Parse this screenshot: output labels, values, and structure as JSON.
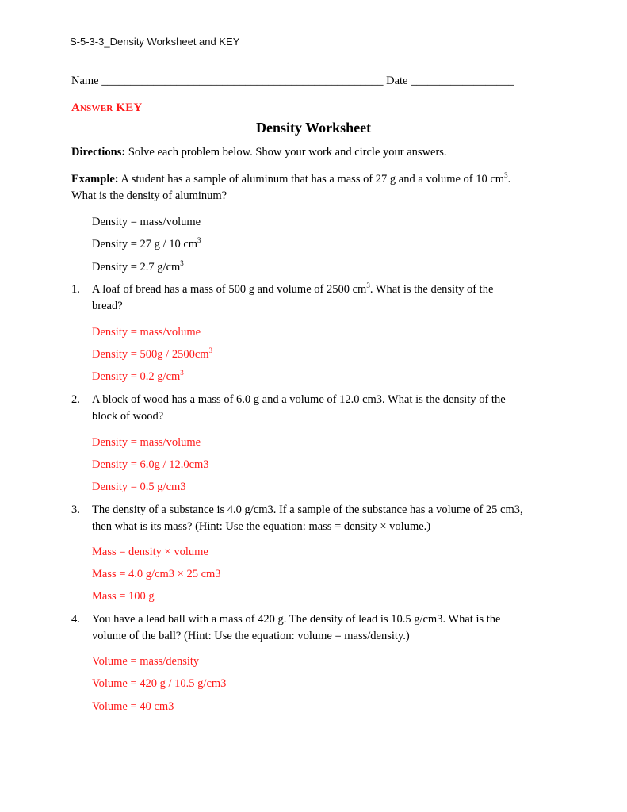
{
  "header": {
    "file_title": "S-5-3-3_Density Worksheet and KEY"
  },
  "form": {
    "name_label": "Name",
    "name_blank": "_________________________________________________",
    "date_label": "Date",
    "date_blank": "__________________"
  },
  "answer_key_label": "Answer KEY",
  "title": "Density Worksheet",
  "directions": {
    "label": "Directions:",
    "text": " Solve each problem below. Show your work and circle your answers."
  },
  "example": {
    "label": "Example:",
    "text_line1": " A student has a sample of aluminum that has a mass of 27 g and a volume of 10 cm",
    "sup": "3",
    "text_line1_end": ".",
    "text_line2": "What is the density of aluminum?",
    "steps": [
      {
        "text": "Density = mass/volume",
        "sup": ""
      },
      {
        "text": "Density = 27 g / 10 cm",
        "sup": "3"
      },
      {
        "text": "Density = 2.7 g/cm",
        "sup": "3"
      }
    ]
  },
  "problems": [
    {
      "number": "1.",
      "line1": "A loaf of bread has a mass of 500 g and volume of 2500 cm",
      "line1_sup": "3",
      "line1_end": ". What is the density of the",
      "line2": "bread?",
      "answers": [
        {
          "text": "Density = mass/volume",
          "sup": ""
        },
        {
          "text": "Density = 500g / 2500cm",
          "sup": "3"
        },
        {
          "text": "Density = 0.2 g/cm",
          "sup": "3"
        }
      ]
    },
    {
      "number": "2.",
      "line1": "A block of wood has a mass of 6.0 g and a volume of 12.0 cm3. What is the density of the",
      "line2": "block of wood?",
      "answers": [
        {
          "text": "Density = mass/volume"
        },
        {
          "text": "Density = 6.0g / 12.0cm3"
        },
        {
          "text": "Density = 0.5 g/cm3"
        }
      ]
    },
    {
      "number": "3.",
      "line1": "The density of a substance is 4.0 g/cm3. If a sample of the substance has a volume of 25 cm3,",
      "line2": "then what is its mass? (Hint: Use the equation: mass = density × volume.)",
      "answers": [
        {
          "text": "Mass = density × volume"
        },
        {
          "text": "Mass = 4.0 g/cm3 × 25 cm3"
        },
        {
          "text": "Mass = 100 g"
        }
      ]
    },
    {
      "number": "4.",
      "line1": "You have a lead ball with a mass of 420 g. The density of lead is 10.5 g/cm3. What is the",
      "line2": "volume of the ball? (Hint: Use the equation: volume = mass/density.)",
      "answers": [
        {
          "text": "Volume = mass/density"
        },
        {
          "text": "Volume = 420 g / 10.5 g/cm3"
        },
        {
          "text": "Volume = 40 cm3"
        }
      ]
    }
  ],
  "colors": {
    "answer": "#ff1a1a",
    "text": "#000000"
  }
}
